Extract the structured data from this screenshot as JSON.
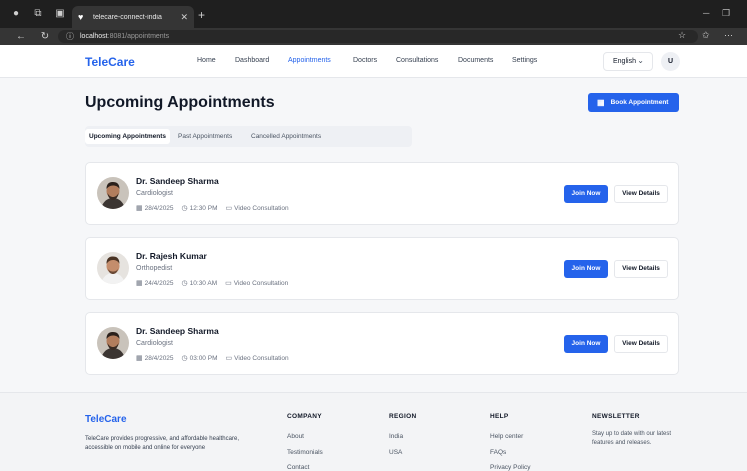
{
  "browser": {
    "tab_title": "telecare-connect-india",
    "url_host": "localhost",
    "url_path": ":8081/appointments"
  },
  "header": {
    "logo": "TeleCare",
    "nav": [
      {
        "label": "Home"
      },
      {
        "label": "Dashboard"
      },
      {
        "label": "Appointments"
      },
      {
        "label": "Doctors"
      },
      {
        "label": "Consultations"
      },
      {
        "label": "Documents"
      },
      {
        "label": "Settings"
      }
    ],
    "active_nav": "Appointments",
    "language": "English",
    "user_initial": "U"
  },
  "main": {
    "title": "Upcoming Appointments",
    "book_button": "Book Appointment",
    "tabs": [
      {
        "label": "Upcoming Appointments"
      },
      {
        "label": "Past Appointments"
      },
      {
        "label": "Cancelled Appointments"
      }
    ],
    "active_tab": "Upcoming Appointments",
    "appointments": [
      {
        "doctor": "Dr. Sandeep Sharma",
        "specialty": "Cardiologist",
        "date": "28/4/2025",
        "time": "12:30 PM",
        "type": "Video Consultation",
        "join": "Join Now",
        "details": "View Details"
      },
      {
        "doctor": "Dr. Rajesh Kumar",
        "specialty": "Orthopedist",
        "date": "24/4/2025",
        "time": "10:30 AM",
        "type": "Video Consultation",
        "join": "Join Now",
        "details": "View Details"
      },
      {
        "doctor": "Dr. Sandeep Sharma",
        "specialty": "Cardiologist",
        "date": "28/4/2025",
        "time": "03:00 PM",
        "type": "Video Consultation",
        "join": "Join Now",
        "details": "View Details"
      }
    ]
  },
  "footer": {
    "logo": "TeleCare",
    "description": "TeleCare provides progressive, and affordable healthcare, accessible on mobile and online for everyone",
    "company": {
      "heading": "COMPANY",
      "links": [
        "About",
        "Testimonials",
        "Contact"
      ]
    },
    "region": {
      "heading": "REGION",
      "links": [
        "India",
        "USA"
      ]
    },
    "help": {
      "heading": "HELP",
      "links": [
        "Help center",
        "FAQs",
        "Privacy Policy"
      ]
    },
    "newsletter": {
      "heading": "NEWSLETTER",
      "text": "Stay up to date with our latest features and releases."
    }
  },
  "colors": {
    "primary": "#2563eb",
    "browser_dark": "#1f1f1f",
    "page_bg": "#f6f7f9"
  }
}
